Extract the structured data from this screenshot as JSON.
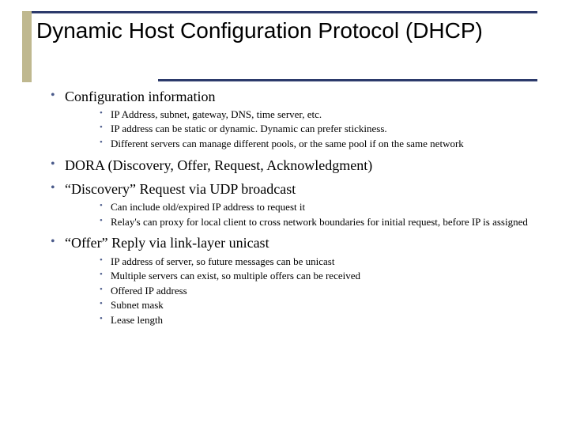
{
  "title": "Dynamic Host Configuration Protocol (DHCP)",
  "bullets": [
    {
      "text": "Configuration information",
      "sub": [
        "IP Address, subnet, gateway, DNS, time server, etc.",
        "IP address can be static or dynamic. Dynamic can prefer stickiness.",
        "Different servers can manage different pools, or the same pool if on the same network"
      ]
    },
    {
      "text": "DORA (Discovery, Offer, Request, Acknowledgment)",
      "sub": []
    },
    {
      "text": "“Discovery” Request via UDP broadcast",
      "sub": [
        "Can include old/expired IP address to request it",
        "Relay's can proxy for local client to cross network boundaries for initial request, before IP is assigned"
      ]
    },
    {
      "text": "“Offer” Reply via link-layer unicast",
      "sub": [
        "IP address of server, so future messages can be unicast",
        "Multiple servers can exist, so multiple offers can be received",
        "Offered IP address",
        "Subnet mask",
        "Lease length"
      ]
    }
  ]
}
